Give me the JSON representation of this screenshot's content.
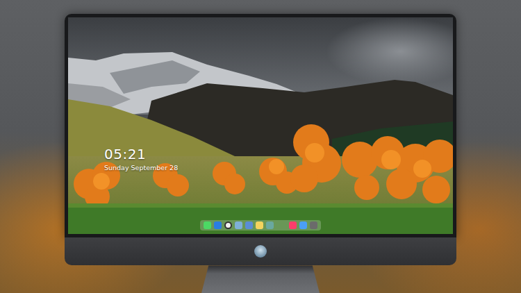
{
  "screen": {
    "clock": {
      "time": "05:21",
      "date": "Sunday September 28"
    }
  }
}
